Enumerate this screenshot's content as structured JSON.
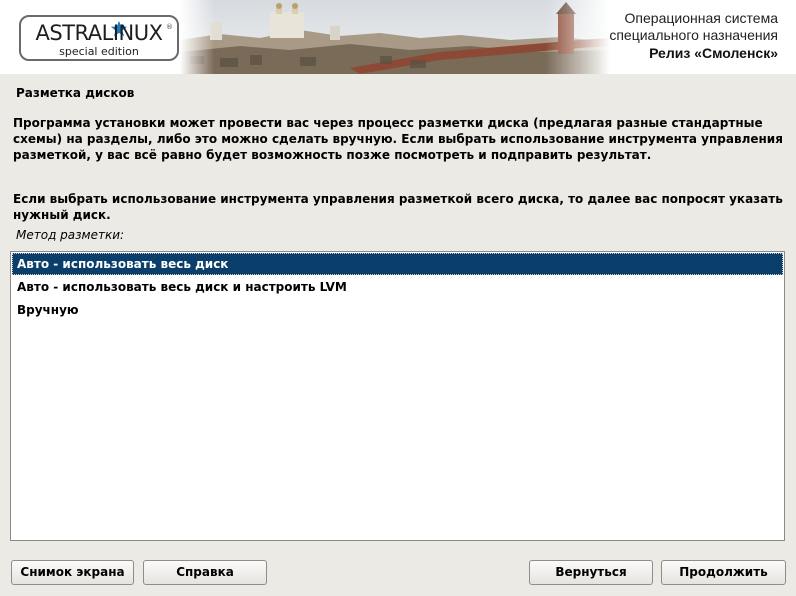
{
  "banner": {
    "logo_text": "ASTRALINUX",
    "logo_registered": "®",
    "logo_sub": "special edition",
    "os_title_line1": "Операционная система",
    "os_title_line2": "специального назначения",
    "release": "Релиз «Смоленск»",
    "accent_color": "#1a7ac4"
  },
  "main": {
    "section_title": "Разметка дисков",
    "description_1": "Программа установки может провести вас через процесс разметки диска (предлагая разные стандартные схемы) на разделы, либо это можно сделать вручную. Если выбрать использование инструмента управления разметкой, у вас всё равно будет возможность позже посмотреть и подправить результат.",
    "description_2": "Если выбрать использование инструмента управления разметкой всего диска, то далее вас попросят указать нужный диск.",
    "method_label": "Метод разметки:",
    "options": [
      {
        "label": "Авто - использовать весь диск",
        "selected": true
      },
      {
        "label": "Авто - использовать весь диск и настроить LVM",
        "selected": false
      },
      {
        "label": "Вручную",
        "selected": false
      }
    ],
    "selected_color": "#0a3f6b"
  },
  "buttons": {
    "screenshot": "Снимок экрана",
    "help": "Справка",
    "back": "Вернуться",
    "continue": "Продолжить"
  }
}
